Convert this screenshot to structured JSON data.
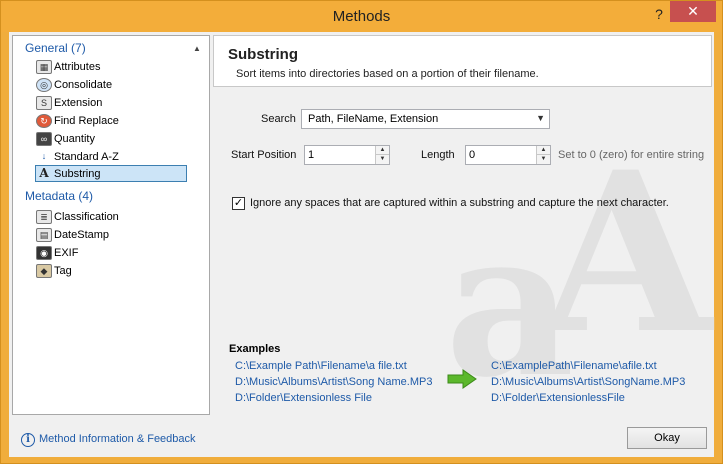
{
  "window": {
    "title": "Methods",
    "help": "?",
    "close": "✕"
  },
  "sidebar": {
    "groups": [
      {
        "label": "General (7)",
        "items": [
          {
            "label": "Attributes",
            "icon": "attributes-icon"
          },
          {
            "label": "Consolidate",
            "icon": "consolidate-icon"
          },
          {
            "label": "Extension",
            "icon": "extension-icon"
          },
          {
            "label": "Find Replace",
            "icon": "find-replace-icon"
          },
          {
            "label": "Quantity",
            "icon": "quantity-icon"
          },
          {
            "label": "Standard A-Z",
            "icon": "standard-az-icon"
          },
          {
            "label": "Substring",
            "icon": "substring-icon",
            "selected": true
          }
        ]
      },
      {
        "label": "Metadata (4)",
        "items": [
          {
            "label": "Classification",
            "icon": "classification-icon"
          },
          {
            "label": "DateStamp",
            "icon": "datestamp-icon"
          },
          {
            "label": "EXIF",
            "icon": "exif-icon"
          },
          {
            "label": "Tag",
            "icon": "tag-icon"
          }
        ]
      }
    ]
  },
  "main": {
    "title": "Substring",
    "description": "Sort items into directories based on a portion of their filename.",
    "search_label": "Search",
    "search_value": "Path, FileName, Extension",
    "start_label": "Start Position",
    "start_value": "1",
    "length_label": "Length",
    "length_value": "0",
    "length_hint": "Set to 0 (zero) for entire string",
    "ignore_checked": true,
    "ignore_label": "Ignore any spaces that are captured within a substring and capture the next character.",
    "examples_title": "Examples",
    "examples_before": [
      "C:\\Example Path\\Filename\\a file.txt",
      "D:\\Music\\Albums\\Artist\\Song Name.MP3",
      "D:\\Folder\\Extensionless File"
    ],
    "examples_after": [
      "C:\\ExamplePath\\Filename\\afile.txt",
      "D:\\Music\\Albums\\Artist\\SongName.MP3",
      "D:\\Folder\\ExtensionlessFile"
    ]
  },
  "footer": {
    "info_link": "Method Information & Feedback",
    "okay": "Okay"
  },
  "colors": {
    "title_bar": "#f3ad3a",
    "link": "#1e5aa8",
    "selected_bg": "#cce4f7",
    "arrow": "#5cb82c"
  }
}
